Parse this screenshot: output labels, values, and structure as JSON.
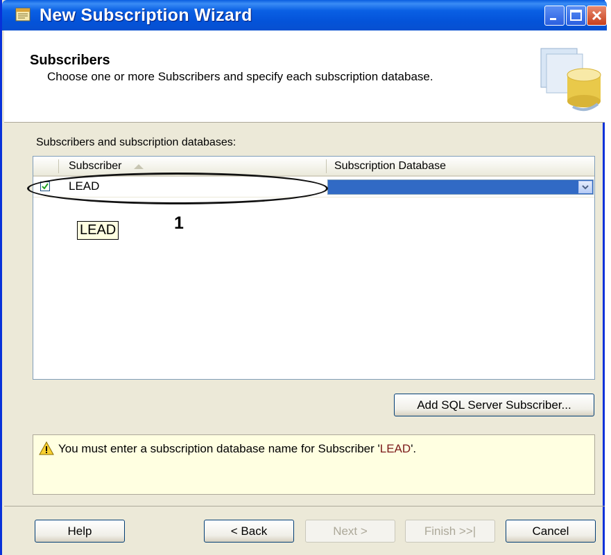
{
  "window": {
    "title": "New Subscription Wizard",
    "accent": "#0a5ee0"
  },
  "header": {
    "title": "Subscribers",
    "subtitle": "Choose one or more Subscribers and specify each subscription database."
  },
  "subscribers_label": "Subscribers and subscription databases:",
  "grid": {
    "columns": [
      "Subscriber",
      "Subscription Database"
    ],
    "rows": [
      {
        "subscriber": "LEAD",
        "checked": true,
        "database": ""
      }
    ],
    "sort_icon": "sort-ascending-icon"
  },
  "tooltip": "LEAD",
  "callout": "1",
  "add_subscriber_button": "Add SQL Server Subscriber...",
  "message": {
    "icon": "warning-icon",
    "prefix": "You must enter a subscription database name for Subscriber '",
    "name": "LEAD",
    "suffix": "'."
  },
  "buttons": {
    "help": "Help",
    "back": "< Back",
    "next": "Next >",
    "finish": "Finish >>|",
    "cancel": "Cancel"
  }
}
